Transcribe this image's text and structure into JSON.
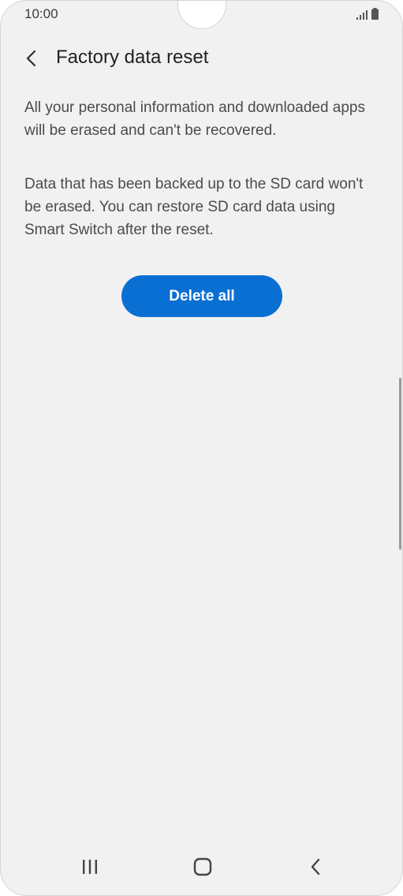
{
  "status_bar": {
    "time": "10:00",
    "signal_icon": "signal-bars-icon",
    "battery_icon": "battery-icon"
  },
  "header": {
    "back_icon": "chevron-left-icon",
    "title": "Factory data reset"
  },
  "content": {
    "paragraph_1": "All your personal information and downloaded apps will be erased and can't be recovered.",
    "paragraph_2": "Data that has been backed up to the SD card won't be erased. You can restore SD card data using Smart Switch after the reset.",
    "delete_all_label": "Delete all"
  },
  "nav_bar": {
    "recents_icon": "recents-icon",
    "home_icon": "home-icon",
    "back_icon": "back-icon"
  },
  "colors": {
    "accent": "#0a6fd3",
    "background": "#f1f1f1",
    "title_text": "#222222",
    "body_text": "#4b4b4b"
  }
}
